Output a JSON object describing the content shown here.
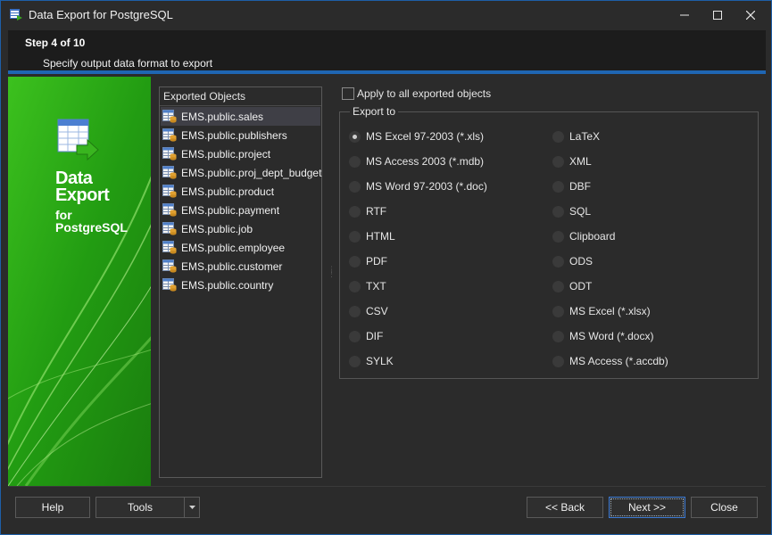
{
  "window": {
    "title": "Data Export for PostgreSQL"
  },
  "header": {
    "step": "Step 4 of 10",
    "description": "Specify output data format to export"
  },
  "banner": {
    "line1": "Data",
    "line2": "Export",
    "line3": "for",
    "line4": "PostgreSQL"
  },
  "objects": {
    "header": "Exported Objects",
    "items": [
      "EMS.public.sales",
      "EMS.public.publishers",
      "EMS.public.project",
      "EMS.public.proj_dept_budget",
      "EMS.public.product",
      "EMS.public.payment",
      "EMS.public.job",
      "EMS.public.employee",
      "EMS.public.customer",
      "EMS.public.country"
    ],
    "selected_index": 0
  },
  "apply_all": {
    "label": "Apply to all exported objects",
    "checked": false
  },
  "export_to": {
    "title": "Export to",
    "left": [
      "MS Excel 97-2003 (*.xls)",
      "MS Access 2003 (*.mdb)",
      "MS Word 97-2003 (*.doc)",
      "RTF",
      "HTML",
      "PDF",
      "TXT",
      "CSV",
      "DIF",
      "SYLK"
    ],
    "right": [
      "LaTeX",
      "XML",
      "DBF",
      "SQL",
      "Clipboard",
      "ODS",
      "ODT",
      "MS Excel (*.xlsx)",
      "MS Word (*.docx)",
      "MS Access  (*.accdb)"
    ],
    "selected": "MS Excel 97-2003 (*.xls)"
  },
  "buttons": {
    "help": "Help",
    "tools": "Tools",
    "back": "<< Back",
    "next": "Next >>",
    "close": "Close"
  },
  "colors": {
    "accent": "#1f66b3",
    "banner_green": "#2ea818"
  }
}
